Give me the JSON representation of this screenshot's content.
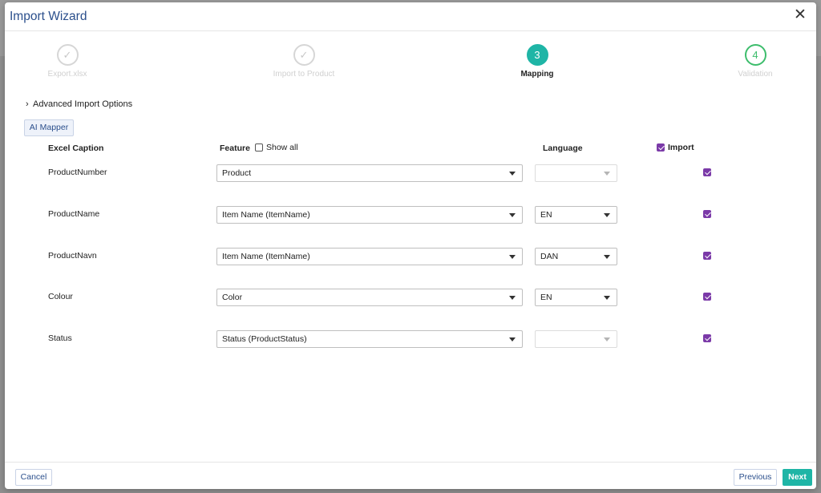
{
  "dialog": {
    "title": "Import Wizard"
  },
  "steps": [
    {
      "number": "✓",
      "label": "Export.xlsx",
      "state": "done"
    },
    {
      "number": "✓",
      "label": "Import to Product",
      "state": "done"
    },
    {
      "number": "3",
      "label": "Mapping",
      "state": "active"
    },
    {
      "number": "4",
      "label": "Validation",
      "state": "pending"
    }
  ],
  "advanced_options_label": "Advanced Import Options",
  "ai_mapper_label": "AI Mapper",
  "columns": {
    "excel_caption": "Excel Caption",
    "feature": "Feature",
    "show_all": "Show all",
    "language": "Language",
    "import": "Import"
  },
  "rows": [
    {
      "caption": "ProductNumber",
      "feature": "Product",
      "language": "",
      "import": true
    },
    {
      "caption": "ProductName",
      "feature": "Item Name (ItemName)",
      "language": "EN",
      "import": true
    },
    {
      "caption": "ProductNavn",
      "feature": "Item Name (ItemName)",
      "language": "DAN",
      "import": true
    },
    {
      "caption": "Colour",
      "feature": "Color",
      "language": "EN",
      "import": true
    },
    {
      "caption": "Status",
      "feature": "Status (ProductStatus)",
      "language": "",
      "import": true
    }
  ],
  "footer": {
    "cancel": "Cancel",
    "previous": "Previous",
    "next": "Next"
  },
  "colors": {
    "accent": "#1fb5a6",
    "checkbox": "#7b3aa8",
    "title": "#2b4f8c"
  }
}
